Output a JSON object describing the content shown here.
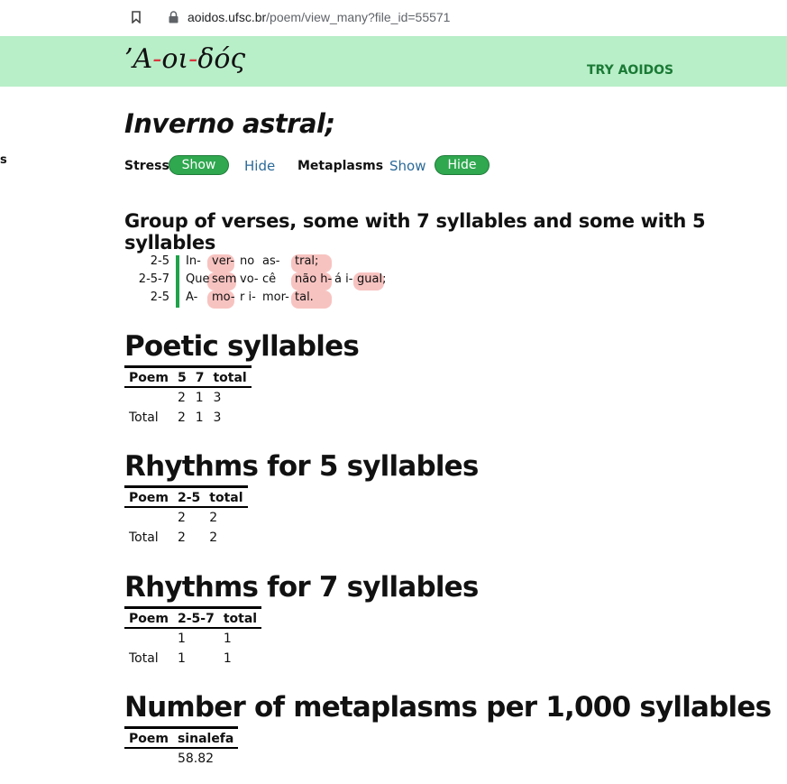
{
  "browser": {
    "url_host": "aoidos.ufsc.br",
    "url_path": "/poem/view_many?file_id=55571"
  },
  "header": {
    "logo_parts": [
      "’A",
      "-",
      "οι",
      "-",
      "δός"
    ],
    "try_label": "TRY AOIDOS"
  },
  "sidebar_cut": "s",
  "poem": {
    "title": "Inverno astral;"
  },
  "controls": {
    "stress_label": "Stress",
    "stress_show": "Show",
    "stress_hide": "Hide",
    "metaplasms_label": "Metaplasms",
    "meta_show": "Show",
    "meta_hide": "Hide"
  },
  "group_heading": "Group of verses, some with 7 syllables and some with 5 syllables",
  "verses": [
    {
      "rhythm": "2-5",
      "syllables": [
        "In-",
        "ver-",
        "no",
        "as-",
        "tral;"
      ]
    },
    {
      "rhythm": "2-5-7",
      "syllables": [
        "Que",
        "sem",
        "vo-",
        "cê",
        "não h-",
        "á i-",
        "gual;"
      ]
    },
    {
      "rhythm": "2-5",
      "syllables": [
        "A-",
        "mo-",
        "r i-",
        "mor-",
        "tal."
      ]
    }
  ],
  "sections": {
    "poetic": {
      "title": "Poetic syllables",
      "headers": [
        "Poem",
        "5",
        "7",
        "total"
      ],
      "rows": [
        [
          "",
          "2",
          "1",
          "3"
        ],
        [
          "Total",
          "2",
          "1",
          "3"
        ]
      ]
    },
    "rhythm5": {
      "title": "Rhythms for 5 syllables",
      "headers": [
        "Poem",
        "2-5",
        "total"
      ],
      "rows": [
        [
          "",
          "2",
          "2"
        ],
        [
          "Total",
          "2",
          "2"
        ]
      ]
    },
    "rhythm7": {
      "title": "Rhythms for 7 syllables",
      "headers": [
        "Poem",
        "2-5-7",
        "total"
      ],
      "rows": [
        [
          "",
          "1",
          "1"
        ],
        [
          "Total",
          "1",
          "1"
        ]
      ]
    },
    "metaplasms": {
      "title": "Number of metaplasms per 1,000 syllables",
      "headers": [
        "Poem",
        "sinalefa"
      ],
      "rows": [
        [
          "",
          "58.82"
        ]
      ]
    }
  }
}
